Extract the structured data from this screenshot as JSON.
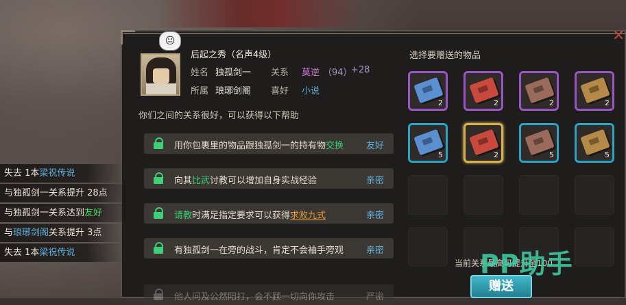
{
  "npc": {
    "title": "后起之秀（名声4级）",
    "name_label": "姓名",
    "name": "独孤剑一",
    "relation_label": "关系",
    "relation": "莫逆",
    "relation_score": "（94）",
    "relation_delta": "+28",
    "faction_label": "所属",
    "faction": "琅琊剑阁",
    "hobby_label": "喜好",
    "hobby": "小说",
    "speech_icon": "😐"
  },
  "intro_text": "你们之间的关系很好，可以获得以下帮助",
  "help_items": [
    {
      "pre": "用你包裹里的物品跟独孤剑一的持有物",
      "hl": "交换",
      "post": "",
      "tag": "友好"
    },
    {
      "pre": "向其",
      "hl": "比武",
      "post": "讨教可以增加自身实战经验",
      "tag": "亲密"
    },
    {
      "pre": "",
      "hl": "请教",
      "post": "时满足指定要求可以获得",
      "hl2": "求败九式",
      "tag": "亲密"
    },
    {
      "pre": "有独孤剑一在旁的战斗，肯定不会袖手旁观",
      "hl": "",
      "post": "",
      "tag": "亲密"
    },
    {
      "pre": "他人问及公然阳打，会不顾一切向你攻击",
      "hl": "",
      "post": "",
      "tag": "严密"
    }
  ],
  "gift_panel": {
    "title": "选择要赠送的物品",
    "items": [
      {
        "color": "#5a8fd0",
        "count": "2",
        "rarity": "purple"
      },
      {
        "color": "#c94a3c",
        "count": "2",
        "rarity": "purple"
      },
      {
        "color": "#9a6b5a",
        "count": "2",
        "rarity": "purple"
      },
      {
        "color": "#b58a48",
        "count": "2",
        "rarity": "purple"
      },
      {
        "color": "#5a8fd0",
        "count": "5",
        "rarity": "cyan"
      },
      {
        "color": "#c94a3c",
        "count": "2",
        "rarity": "gold"
      },
      {
        "color": "#9a6b5a",
        "count": "5",
        "rarity": "cyan"
      },
      {
        "color": "#b58a48",
        "count": "5",
        "rarity": "cyan"
      }
    ],
    "footer": "当前关系最高可提升至100",
    "give_button": "赠送"
  },
  "log": [
    {
      "pre": "失去 1本",
      "hl": "梁祝传说",
      "post": "",
      "style": "blue"
    },
    {
      "pre": "与独孤剑一关系提升 28点",
      "hl": "",
      "post": "",
      "style": ""
    },
    {
      "pre": "与独孤剑一关系达到",
      "hl": "友好",
      "post": "",
      "style": "green"
    },
    {
      "pre": "与",
      "hl": "琅琊剑阁",
      "post": "关系提升 3点",
      "style": "blue"
    },
    {
      "pre": "失去 1本",
      "hl": "梁祝传说",
      "post": "",
      "style": "blue"
    }
  ],
  "watermark": "PP助手",
  "close_icon": "close-icon",
  "colors": {
    "relation": "#d078d8",
    "hobby": "#5fb0dd",
    "lock": "#3fcf78",
    "highlight": "#e79a3a"
  }
}
